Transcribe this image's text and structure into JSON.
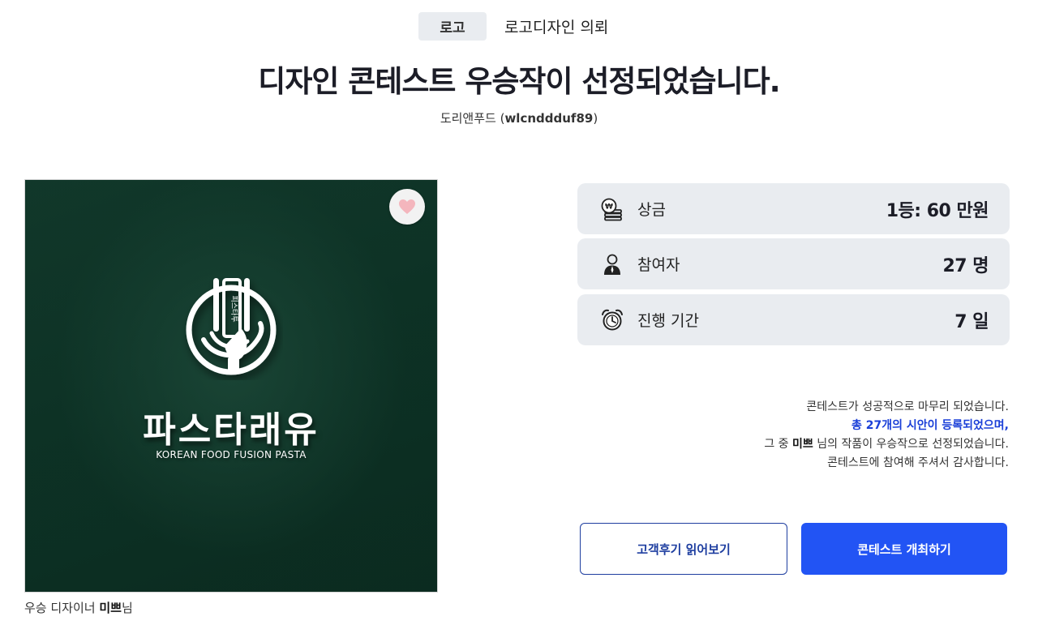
{
  "category": {
    "badge": "로고",
    "title": "로고디자인 의뢰"
  },
  "headline": "디자인 콘테스트 우승작이 선정되었습니다.",
  "client": {
    "name": "도리앤푸드",
    "id": "wlcnddduf89"
  },
  "winner_image": {
    "logo_vertical_text": "피스타투",
    "logo_text": "파스타래유",
    "logo_subtext": "KOREAN FOOD FUSION PASTA"
  },
  "designer": {
    "prefix": "우승 디자이너",
    "name": "미쁘",
    "suffix": "님"
  },
  "stats": [
    {
      "icon": "coin-stack-icon",
      "label": "상금",
      "value": "1등: 60 만원"
    },
    {
      "icon": "person-icon",
      "label": "참여자",
      "value": "27 명"
    },
    {
      "icon": "alarm-clock-icon",
      "label": "진행 기간",
      "value": "7 일"
    }
  ],
  "message": {
    "line1": "콘테스트가 성공적으로 마무리 되었습니다.",
    "line2": "총 27개의 시안이 등록되었으며,",
    "line3_prefix": "그 중",
    "line3_name": "미쁘",
    "line3_suffix": "님의 작품이 우승작으로 선정되었습니다.",
    "line4": "콘테스트에 참여해 주셔서 감사합니다."
  },
  "buttons": {
    "reviews": "고객후기 읽어보기",
    "host_contest": "콘테스트 개최하기"
  },
  "colors": {
    "accent_blue": "#2254f4",
    "highlight_text": "#1a3fd8",
    "stat_bg": "#e9ecf0",
    "heart": "#f4b6bd"
  }
}
